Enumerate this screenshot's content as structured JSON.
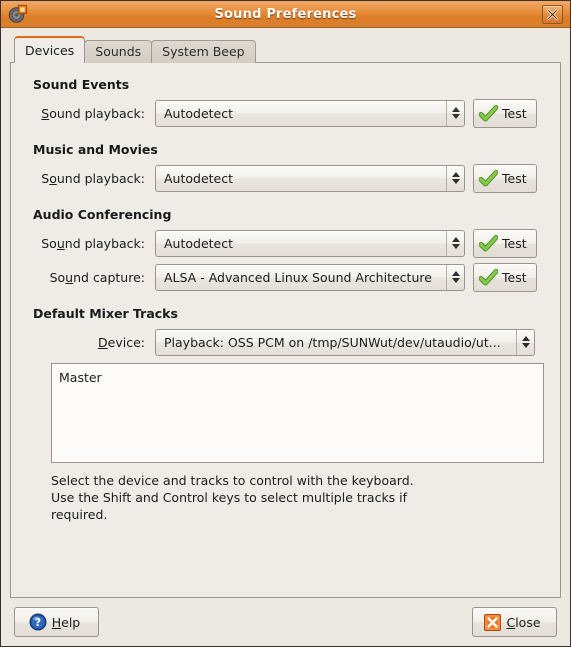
{
  "window": {
    "title": "Sound Preferences",
    "icon": "sound-preferences-icon",
    "close_icon": "window-close-icon"
  },
  "tabs": [
    {
      "label": "Devices",
      "active": true
    },
    {
      "label": "Sounds",
      "active": false
    },
    {
      "label": "System Beep",
      "active": false
    }
  ],
  "sections": {
    "sound_events": {
      "title": "Sound Events",
      "playback": {
        "label_pre": "S",
        "label_mnemonic": "",
        "label_post": "ound playback:",
        "label_full": "Sound playback:",
        "mnemonic_index": 0,
        "value": "Autodetect",
        "test_label": "Test"
      }
    },
    "music_and_movies": {
      "title": "Music and Movies",
      "playback": {
        "label_full": "Sound playback:",
        "mnemonic_index": 1,
        "value": "Autodetect",
        "test_label": "Test"
      }
    },
    "audio_conferencing": {
      "title": "Audio Conferencing",
      "playback": {
        "label_full": "Sound playback:",
        "mnemonic_index": 2,
        "value": "Autodetect",
        "test_label": "Test"
      },
      "capture": {
        "label_full": "Sound capture:",
        "mnemonic_index": 2,
        "value": "ALSA - Advanced Linux Sound Architecture",
        "test_label": "Test"
      }
    },
    "default_mixer_tracks": {
      "title": "Default Mixer Tracks",
      "device": {
        "label_full": "Device:",
        "mnemonic_index": 0,
        "value": "Playback: OSS PCM on /tmp/SUNWut/dev/utaudio/ut..."
      },
      "tracks": [
        "Master"
      ],
      "hint_lines": [
        "Select the device and tracks to control with the keyboard.",
        "Use the Shift and Control keys to select multiple tracks if",
        "required."
      ]
    }
  },
  "actions": {
    "help": {
      "label": "Help",
      "mnemonic_index": 0,
      "icon": "help-question-icon"
    },
    "close": {
      "label": "Close",
      "mnemonic_index": 0,
      "icon": "close-x-icon"
    }
  },
  "colors": {
    "titlebar_accent": "#e2891f",
    "active_tab_underline": "#e2691a",
    "window_bg": "#ece9e3",
    "panel_bg": "#efece7",
    "check_green": "#73b944",
    "help_blue": "#2b5fa8",
    "close_orange": "#e8621a"
  }
}
